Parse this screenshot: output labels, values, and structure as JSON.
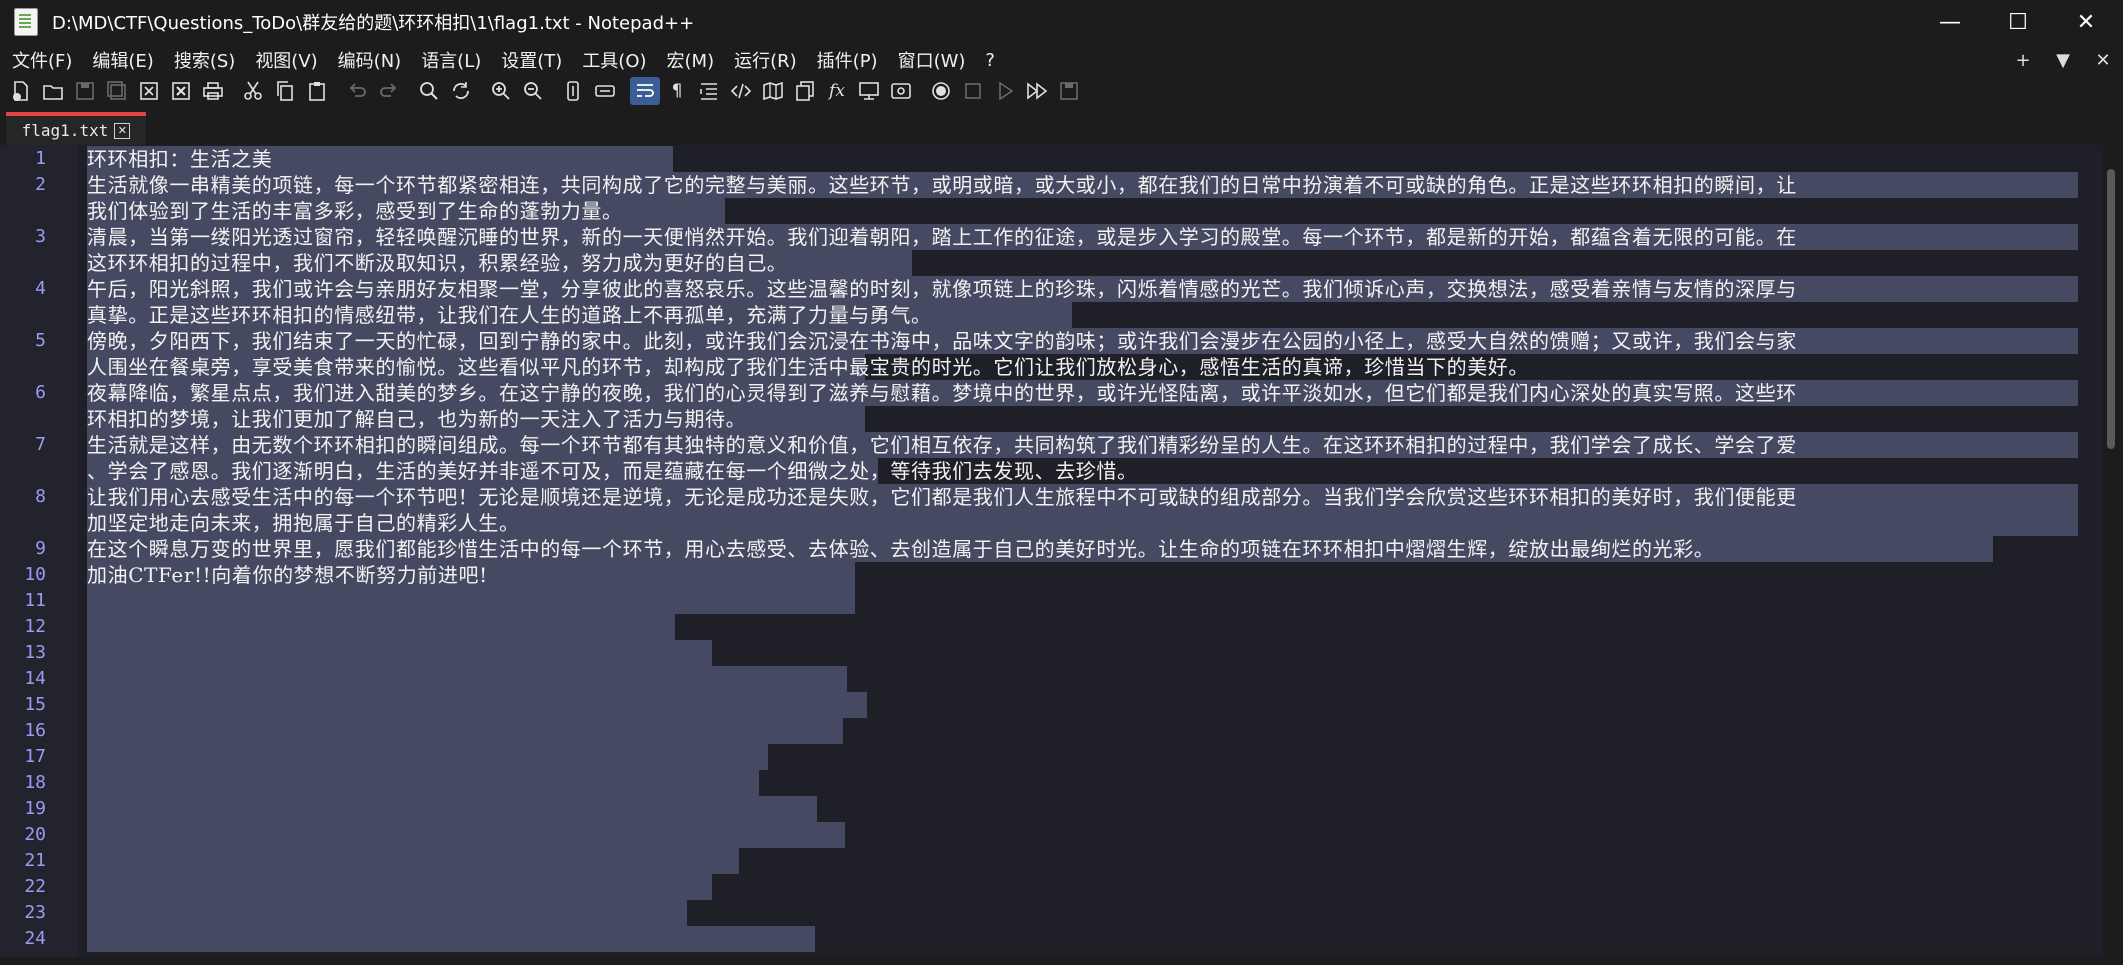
{
  "window": {
    "title": "D:\\MD\\CTF\\Questions_ToDo\\群友给的题\\环环相扣\\1\\flag1.txt - Notepad++",
    "minimize": "—",
    "maximize": "☐",
    "close": "✕"
  },
  "menu": {
    "items": [
      "文件(F)",
      "编辑(E)",
      "搜索(S)",
      "视图(V)",
      "编码(N)",
      "语言(L)",
      "设置(T)",
      "工具(O)",
      "宏(M)",
      "运行(R)",
      "插件(P)",
      "窗口(W)",
      "?"
    ],
    "right": [
      "+",
      "▼",
      "✕"
    ]
  },
  "toolbar": {
    "icons": [
      "new-file-icon",
      "open-file-icon",
      "save-icon",
      "save-all-icon",
      "close-icon",
      "close-all-icon",
      "print-icon",
      "cut-icon",
      "copy-icon",
      "paste-icon",
      "undo-icon",
      "redo-icon",
      "find-icon",
      "replace-icon",
      "zoom-in-icon",
      "zoom-out-icon",
      "sync-vertical-icon",
      "sync-horizontal-icon",
      "word-wrap-icon",
      "show-all-chars-icon",
      "indent-guide-icon",
      "xml-tag-icon",
      "document-map-icon",
      "document-list-icon",
      "function-list-icon",
      "monitor-icon",
      "folder-workspace-icon",
      "record-macro-icon",
      "stop-record-icon",
      "play-macro-icon",
      "run-macro-multiple-icon",
      "save-macro-icon"
    ]
  },
  "tab": {
    "label": "flag1.txt",
    "close": "✕"
  },
  "editor": {
    "line_numbers": [
      "1",
      "2",
      "3",
      "4",
      "5",
      "6",
      "7",
      "8",
      "9",
      "10",
      "11",
      "12",
      "13",
      "14",
      "15",
      "16",
      "17",
      "18",
      "19",
      "20",
      "21",
      "22",
      "23",
      "24"
    ],
    "lines": [
      "环环相扣：生活之美",
      "生活就像一串精美的项链，每一个环节都紧密相连，共同构成了它的完整与美丽。这些环节，或明或暗，或大或小，都在我们的日常中扮演着不可或缺的角色。正是这些环环相扣的瞬间，让",
      "我们体验到了生活的丰富多彩，感受到了生命的蓬勃力量。",
      "清晨，当第一缕阳光透过窗帘，轻轻唤醒沉睡的世界，新的一天便悄然开始。我们迎着朝阳，踏上工作的征途，或是步入学习的殿堂。每一个环节，都是新的开始，都蕴含着无限的可能。在",
      "这环环相扣的过程中，我们不断汲取知识，积累经验，努力成为更好的自己。",
      "午后，阳光斜照，我们或许会与亲朋好友相聚一堂，分享彼此的喜怒哀乐。这些温馨的时刻，就像项链上的珍珠，闪烁着情感的光芒。我们倾诉心声，交换想法，感受着亲情与友情的深厚与",
      "真挚。正是这些环环相扣的情感纽带，让我们在人生的道路上不再孤单，充满了力量与勇气。",
      "傍晚，夕阳西下，我们结束了一天的忙碌，回到宁静的家中。此刻，或许我们会沉浸在书海中，品味文字的韵味；或许我们会漫步在公园的小径上，感受大自然的馈赠；又或许，我们会与家",
      "人围坐在餐桌旁，享受美食带来的愉悦。这些看似平凡的环节，却构成了我们生活中最宝贵的时光。它们让我们放松身心，感悟生活的真谛，珍惜当下的美好。",
      "夜幕降临，繁星点点，我们进入甜美的梦乡。在这宁静的夜晚，我们的心灵得到了滋养与慰藉。梦境中的世界，或许光怪陆离，或许平淡如水，但它们都是我们内心深处的真实写照。这些环",
      "环相扣的梦境，让我们更加了解自己，也为新的一天注入了活力与期待。",
      "生活就是这样，由无数个环环相扣的瞬间组成。每一个环节都有其独特的意义和价值，它们相互依存，共同构筑了我们精彩纷呈的人生。在这环环相扣的过程中，我们学会了成长、学会了爱",
      "、学会了感恩。我们逐渐明白，生活的美好并非遥不可及，而是蕴藏在每一个细微之处，等待我们去发现、去珍惜。",
      "让我们用心去感受生活中的每一个环节吧！无论是顺境还是逆境，无论是成功还是失败，它们都是我们人生旅程中不可或缺的组成部分。当我们学会欣赏这些环环相扣的美好时，我们便能更",
      "加坚定地走向未来，拥抱属于自己的精彩人生。",
      "在这个瞬息万变的世界里，愿我们都能珍惜生活中的每一个环节，用心去感受、去体验、去创造属于自己的美好时光。让生命的项链在环环相扣中熠熠生辉，绽放出最绚烂的光彩。",
      "加油CTFer!!向着你的梦想不断努力前进吧!"
    ]
  },
  "colors": {
    "background": "#1f1f28",
    "selection": "#454a62",
    "line_number": "#9b9bf4",
    "tab_accent": "#e04444",
    "active_tool": "#3a5e95"
  }
}
